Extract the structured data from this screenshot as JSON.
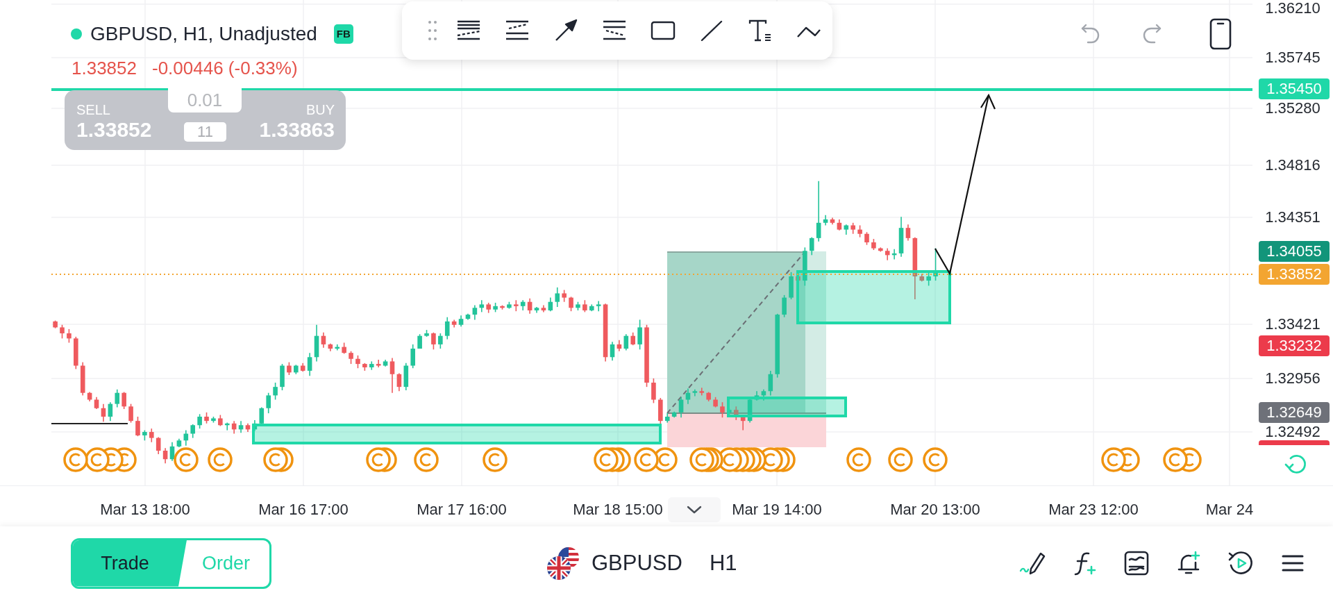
{
  "header": {
    "market_open": true,
    "title": "GBPUSD, H1, Unadjusted",
    "badge": "FB",
    "last_price": "1.33852",
    "change": "-0.00446 (-0.33%)"
  },
  "trade_panel": {
    "sell_label": "SELL",
    "sell_price": "1.33852",
    "lot_size": "0.01",
    "spread": "11",
    "buy_label": "BUY",
    "buy_price": "1.33863"
  },
  "history": {
    "undo_disabled": true,
    "redo_disabled": true
  },
  "price_axis": {
    "labels": [
      "1.36210",
      "1.35745",
      "1.35280",
      "1.34816",
      "1.34351",
      "1.33421",
      "1.32956",
      "1.32492"
    ],
    "tags": [
      {
        "text": "1.35450",
        "color": "#1fd8a8"
      },
      {
        "text": "1.34055",
        "color": "#12957a"
      },
      {
        "text": "1.33852",
        "color": "#f3a531"
      },
      {
        "text": "1.33232",
        "color": "#ec3b4b"
      },
      {
        "text": "1.32649",
        "color": "#6e7179"
      }
    ],
    "clipped_tag": {
      "color": "#ec3b4b"
    }
  },
  "time_axis": {
    "labels": [
      "Mar 13 18:00",
      "Mar 16 17:00",
      "Mar 17 16:00",
      "Mar 18 15:00",
      "Mar 19 14:00",
      "Mar 20 13:00",
      "Mar 23 12:00",
      "Mar 24"
    ]
  },
  "bottom_bar": {
    "modes": [
      {
        "label": "Trade",
        "selected": true
      },
      {
        "label": "Order",
        "selected": false
      }
    ],
    "symbol": "GBPUSD",
    "timeframe": "H1"
  }
}
